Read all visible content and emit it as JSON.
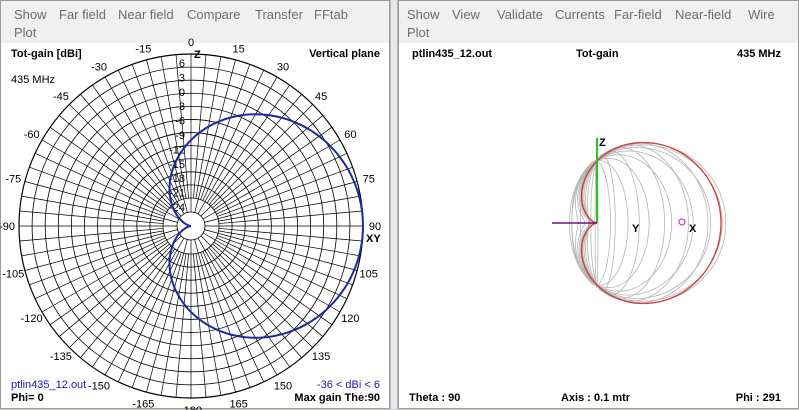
{
  "left_window": {
    "menu": [
      "Show",
      "Far field",
      "Near field",
      "Compare",
      "Transfer",
      "FFtab",
      "Plot"
    ],
    "title": "Tot-gain [dBi]",
    "plane": "Vertical plane",
    "frequency": "435 MHz",
    "filename": "ptlin435_12.out",
    "range": "-36 < dBi < 6",
    "phi": "Phi= 0",
    "max_gain": "Max gain The:90",
    "angle_labels": [
      "0",
      "15",
      "30",
      "45",
      "60",
      "75",
      "90",
      "105",
      "120",
      "135",
      "150",
      "165",
      "-180",
      "-165",
      "-150",
      "-135",
      "-120",
      "-105",
      "-90",
      "-75",
      "-60",
      "-45",
      "-30",
      "-15"
    ],
    "gain_labels": [
      "6",
      "3",
      "0",
      "-3",
      "-6",
      "-9",
      "-12",
      "-15",
      "-18",
      "-21",
      "-24"
    ],
    "axis_z": "Z",
    "axis_xy": "XY",
    "colors": {
      "pattern": "#1e2a9c",
      "grid": "#000000"
    }
  },
  "right_window": {
    "menu": [
      "Show",
      "View",
      "Validate",
      "Currents",
      "Far-field",
      "Near-field",
      "Wire",
      "Plot"
    ],
    "filename": "ptlin435_12.out",
    "title": "Tot-gain",
    "frequency": "435 MHz",
    "theta": "Theta : 90",
    "axis": "Axis : 0.1 mtr",
    "phi": "Phi : 291",
    "axis_z": "Z",
    "axis_y": "Y",
    "axis_x": "X",
    "colors": {
      "outline": "#d23c3c",
      "mesh": "#b4b4b4",
      "z_axis": "#22c822",
      "x_axis": "#7a0a7a",
      "marker": "#c832c8"
    }
  }
}
